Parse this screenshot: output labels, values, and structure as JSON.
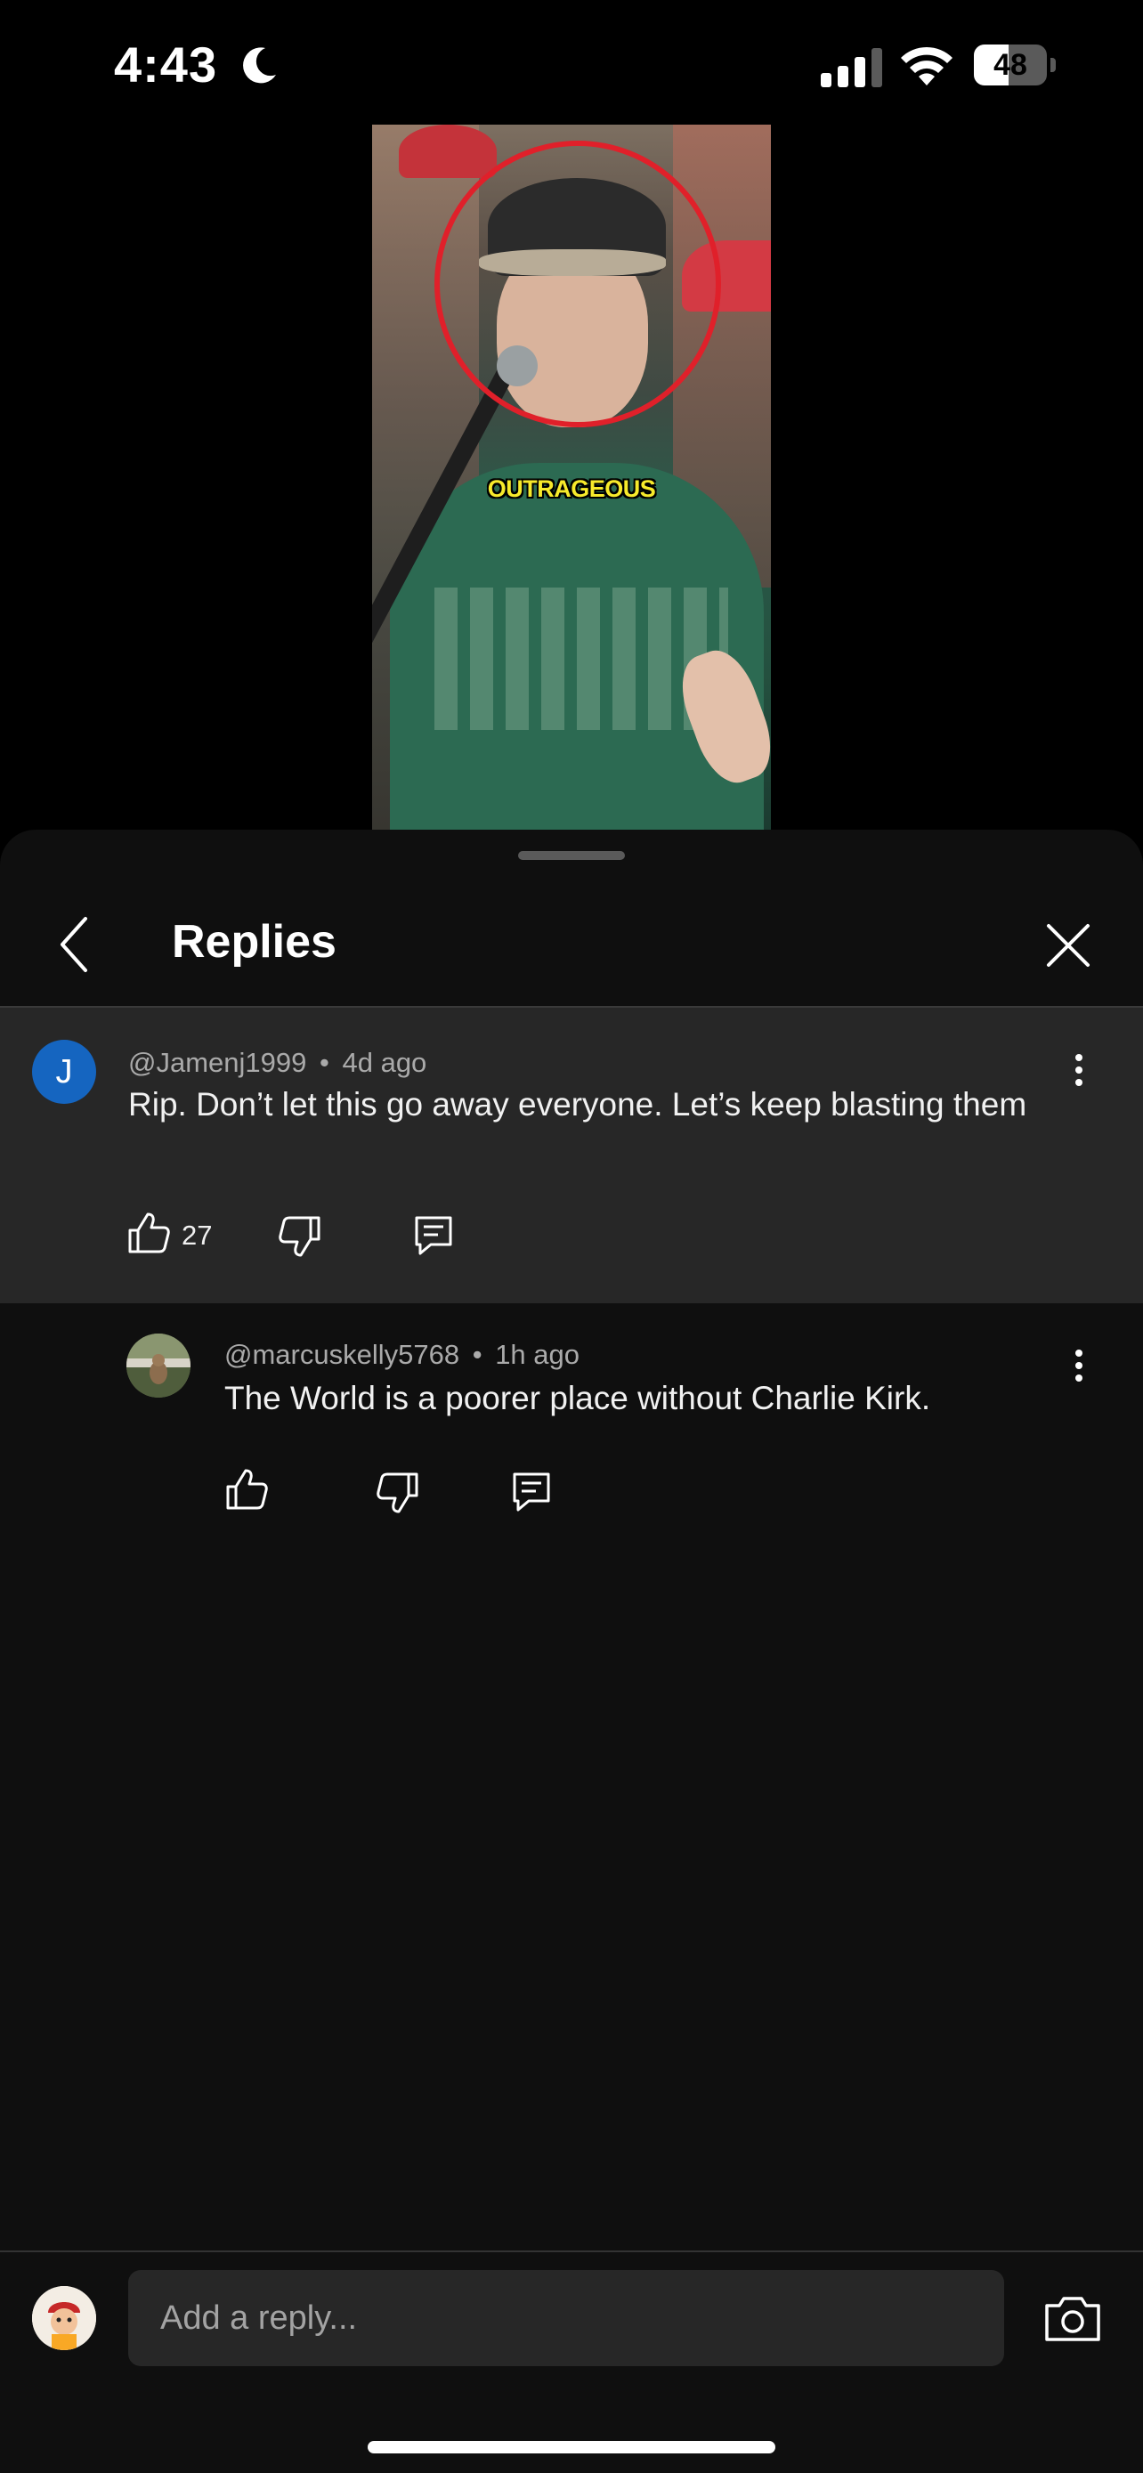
{
  "status_bar": {
    "time": "4:43",
    "battery_level": "48",
    "battery_fraction": 0.48,
    "icons": [
      "moon-icon",
      "signal-icon",
      "wifi-icon",
      "battery-icon"
    ]
  },
  "video": {
    "caption": "OUTRAGEOUS"
  },
  "sheet": {
    "title": "Replies"
  },
  "main_comment": {
    "avatar_letter": "J",
    "author": "@Jamenj1999",
    "separator": "•",
    "time": "4d ago",
    "text": "Rip. Don’t let this go away everyone. Let’s keep blasting them",
    "likes": "27"
  },
  "replies": [
    {
      "author": "@marcuskelly5768",
      "separator": "•",
      "time": "1h ago",
      "text": "The World is a poorer place without Charlie Kirk."
    }
  ],
  "reply_box": {
    "placeholder": "Add a reply..."
  },
  "colors": {
    "sheet_bg": "#0f0f0f",
    "highlight_bg": "#272727",
    "avatar_blue": "#1565c0",
    "caption_yellow": "#f7ea2b",
    "circle_red": "#e0202a"
  }
}
